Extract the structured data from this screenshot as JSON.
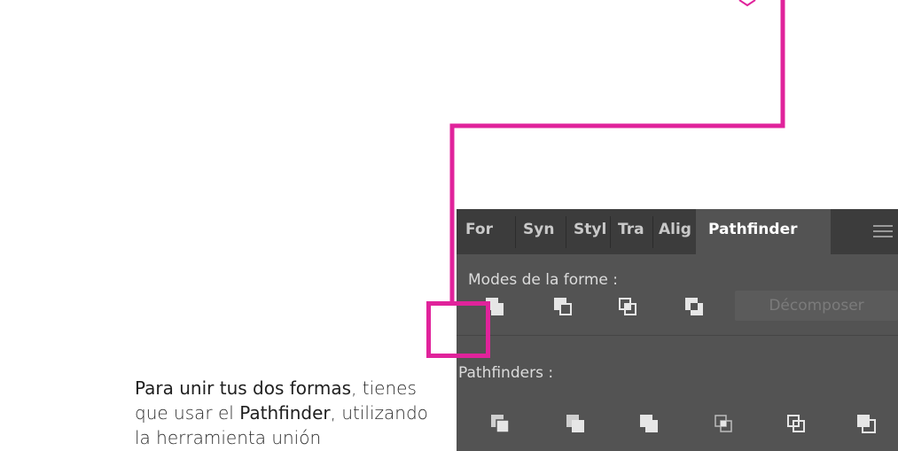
{
  "caption": {
    "line1_strong": "Para unir tus dos formas",
    "line1_rest": ", tienes",
    "line2_a": "que usar el ",
    "line2_strong": "Pathfinder",
    "line2_rest": ", utilizando",
    "line3": "la herramienta unión"
  },
  "panel": {
    "tabs": [
      "For",
      "Syn",
      "Styl",
      "Tra",
      "Alig",
      "Pathfinder"
    ],
    "active_tab": "Pathfinder",
    "shape_modes_label": "Modes de la forme :",
    "shape_modes": [
      "unite-icon",
      "minus-front-icon",
      "intersect-icon",
      "exclude-icon"
    ],
    "expand_label": "Décomposer",
    "pathfinders_label": "Pathfinders :",
    "pathfinders": [
      "divide-icon",
      "trim-icon",
      "merge-icon",
      "crop-icon",
      "outline-icon",
      "minus-back-icon"
    ]
  },
  "colors": {
    "accent": "#e0239b",
    "panel_bg": "#535353",
    "tabbar_bg": "#3c3c3c"
  }
}
